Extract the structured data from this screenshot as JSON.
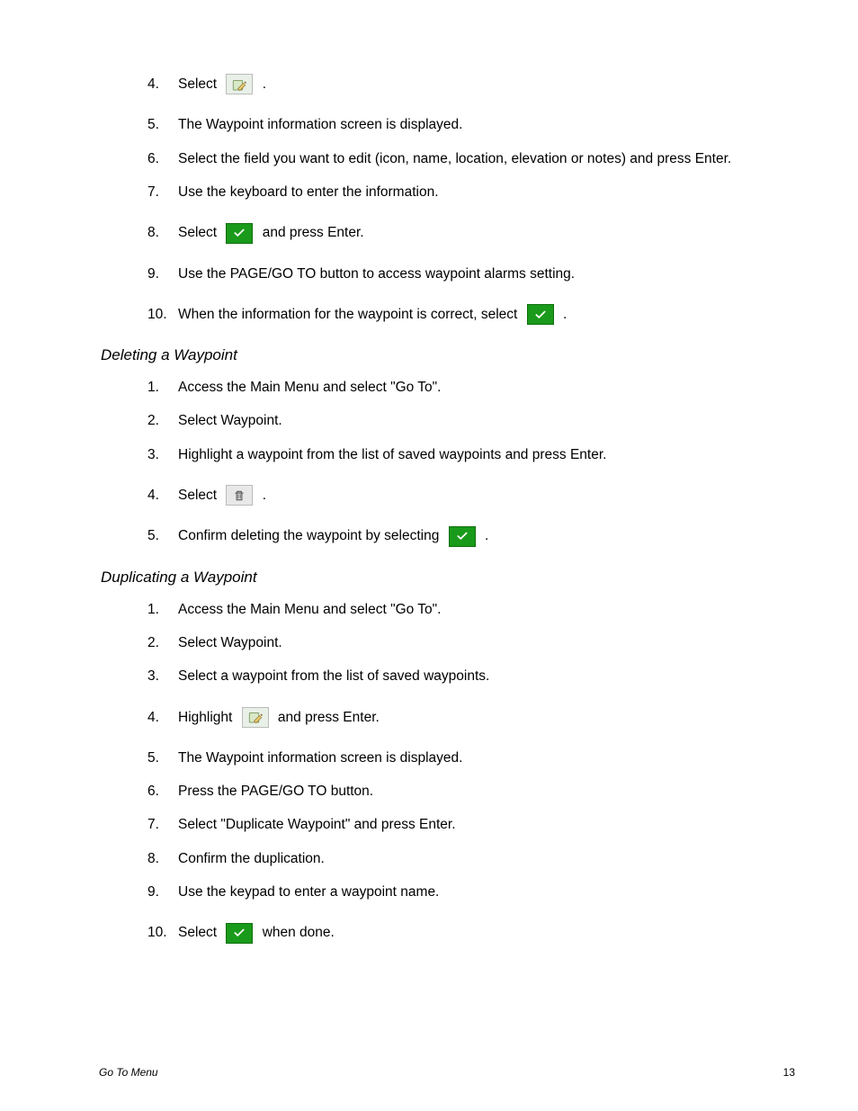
{
  "sections": [
    {
      "steps": [
        {
          "num": "4.",
          "parts": [
            {
              "t": "Select "
            },
            {
              "icon": "edit"
            },
            {
              "t": " ."
            }
          ],
          "iconStep": true
        },
        {
          "num": "5.",
          "parts": [
            {
              "t": "The Waypoint information screen is displayed."
            }
          ]
        },
        {
          "num": "6.",
          "parts": [
            {
              "t": "Select the field you want to edit (icon, name, location, elevation or notes) and press Enter."
            }
          ]
        },
        {
          "num": "7.",
          "parts": [
            {
              "t": "Use the keyboard to enter the information."
            }
          ]
        },
        {
          "num": "8.",
          "parts": [
            {
              "t": "Select "
            },
            {
              "icon": "check"
            },
            {
              "t": " and press Enter."
            }
          ],
          "iconStep": true
        },
        {
          "num": "9.",
          "parts": [
            {
              "t": "Use the PAGE/GO TO button to access waypoint alarms setting."
            }
          ]
        },
        {
          "num": "10.",
          "parts": [
            {
              "t": "When the information for the waypoint is correct, select "
            },
            {
              "icon": "check"
            },
            {
              "t": " ."
            }
          ],
          "iconStep": true
        }
      ]
    },
    {
      "heading": "Deleting a Waypoint",
      "steps": [
        {
          "num": "1.",
          "parts": [
            {
              "t": "Access the Main Menu and select \"Go To\"."
            }
          ]
        },
        {
          "num": "2.",
          "parts": [
            {
              "t": "Select Waypoint."
            }
          ]
        },
        {
          "num": "3.",
          "parts": [
            {
              "t": "Highlight a waypoint from the list of saved waypoints and press Enter."
            }
          ]
        },
        {
          "num": "4.",
          "parts": [
            {
              "t": "Select "
            },
            {
              "icon": "trash"
            },
            {
              "t": " ."
            }
          ],
          "iconStep": true
        },
        {
          "num": "5.",
          "parts": [
            {
              "t": "Confirm deleting the waypoint by selecting "
            },
            {
              "icon": "check"
            },
            {
              "t": " ."
            }
          ],
          "iconStep": true
        }
      ]
    },
    {
      "heading": "Duplicating a Waypoint",
      "steps": [
        {
          "num": "1.",
          "parts": [
            {
              "t": "Access the Main Menu and select \"Go To\"."
            }
          ]
        },
        {
          "num": "2.",
          "parts": [
            {
              "t": "Select Waypoint."
            }
          ]
        },
        {
          "num": "3.",
          "parts": [
            {
              "t": "Select a waypoint from the list of saved waypoints."
            }
          ]
        },
        {
          "num": "4.",
          "parts": [
            {
              "t": "Highlight "
            },
            {
              "icon": "edit"
            },
            {
              "t": " and press Enter."
            }
          ],
          "iconStep": true
        },
        {
          "num": "5.",
          "parts": [
            {
              "t": "The Waypoint information screen is displayed."
            }
          ]
        },
        {
          "num": "6.",
          "parts": [
            {
              "t": "Press the PAGE/GO TO button."
            }
          ]
        },
        {
          "num": "7.",
          "parts": [
            {
              "t": "Select \"Duplicate Waypoint\" and press Enter."
            }
          ]
        },
        {
          "num": "8.",
          "parts": [
            {
              "t": "Confirm the duplication."
            }
          ]
        },
        {
          "num": "9.",
          "parts": [
            {
              "t": "Use the keypad to enter a waypoint name."
            }
          ]
        },
        {
          "num": "10.",
          "parts": [
            {
              "t": "Select "
            },
            {
              "icon": "check"
            },
            {
              "t": " when done."
            }
          ],
          "iconStep": true
        }
      ]
    }
  ],
  "footer": {
    "left": "Go To Menu",
    "right": "13"
  }
}
